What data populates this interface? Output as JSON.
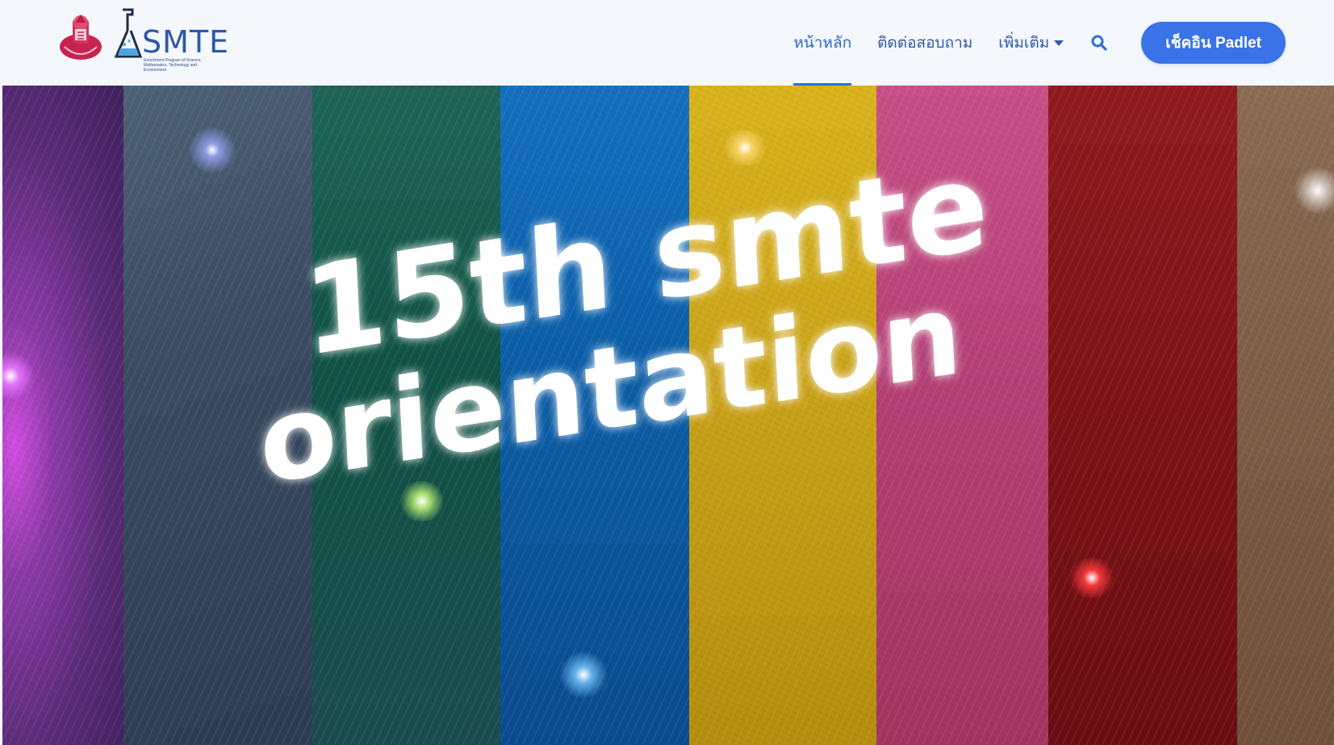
{
  "brand": {
    "name": "SMTE",
    "subtitle": "Enrichment Program of Science, Mathematics, Technology and Environment"
  },
  "nav": {
    "items": [
      {
        "label": "หน้าหลัก",
        "active": true
      },
      {
        "label": "ติดต่อสอบถาม",
        "active": false
      },
      {
        "label": "เพิ่มเติม",
        "active": false,
        "dropdown": true
      }
    ],
    "search_icon": "search-icon",
    "cta_label": "เช็คอิน Padlet"
  },
  "hero": {
    "line1": "15th smte",
    "line2": "orientation"
  },
  "colors": {
    "primary": "#3a73e8",
    "nav_text": "#2e5aa8",
    "navbar_bg": "#f4f7fb"
  }
}
